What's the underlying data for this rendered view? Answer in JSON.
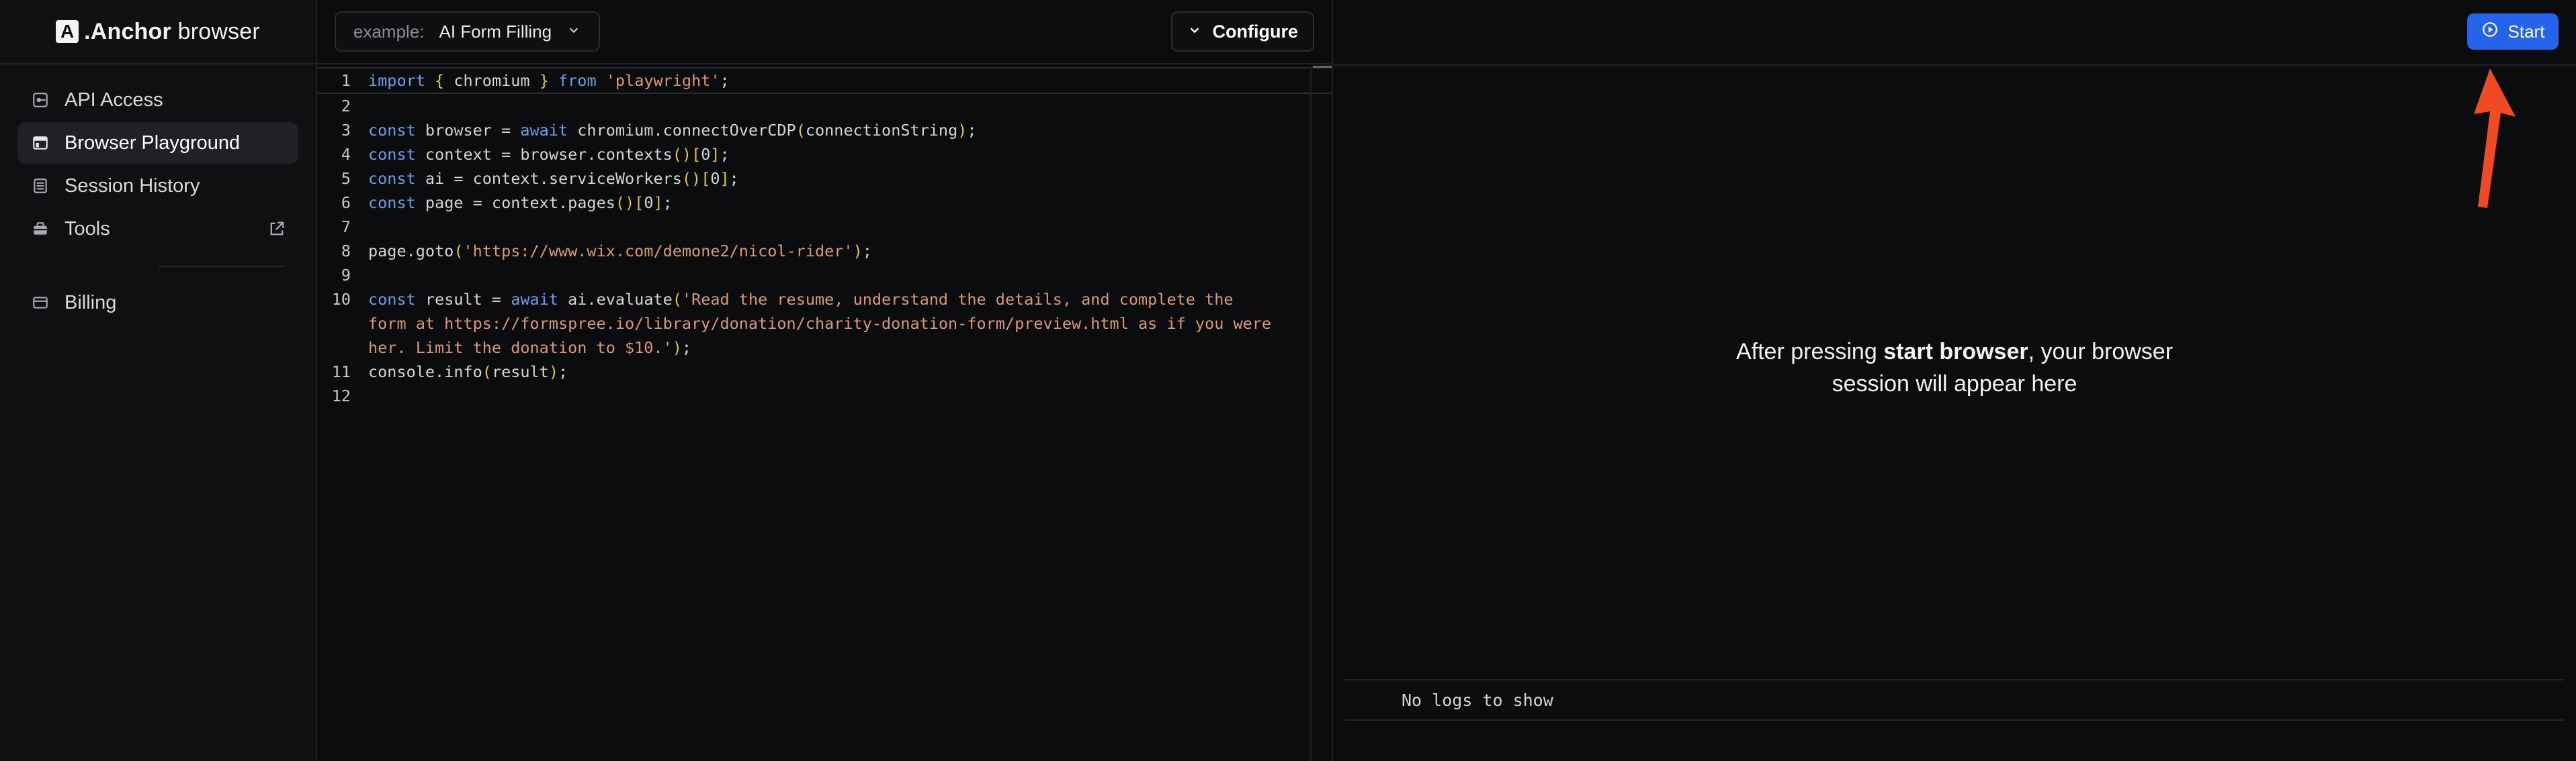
{
  "brand": {
    "logo_letter": "A",
    "name_bold": ".Anchor",
    "name_light": " browser"
  },
  "sidebar": {
    "items": [
      {
        "label": "API Access",
        "icon": "key-icon",
        "active": false
      },
      {
        "label": "Browser Playground",
        "icon": "browser-window-icon",
        "active": true
      },
      {
        "label": "Session History",
        "icon": "list-icon",
        "active": false
      },
      {
        "label": "Tools",
        "icon": "toolbox-icon",
        "active": false,
        "external": true
      },
      {
        "label": "Billing",
        "icon": "credit-card-icon",
        "active": false
      }
    ]
  },
  "editor": {
    "example_prefix": "example:",
    "example_value": "AI Form Filling",
    "configure_label": "Configure",
    "line_numbers": [
      "1",
      "2",
      "3",
      "4",
      "5",
      "6",
      "7",
      "8",
      "9",
      "10",
      "",
      "",
      "11",
      "12"
    ]
  },
  "preview": {
    "start_label": "Start",
    "placeholder_pre": "After pressing ",
    "placeholder_bold": "start browser",
    "placeholder_post": ", your browser",
    "placeholder_line2": "session will appear here",
    "logs_text": "No logs to show"
  },
  "colors": {
    "accent": "#2563eb",
    "arrow": "#f04a23",
    "background": "#0b0c0e"
  }
}
